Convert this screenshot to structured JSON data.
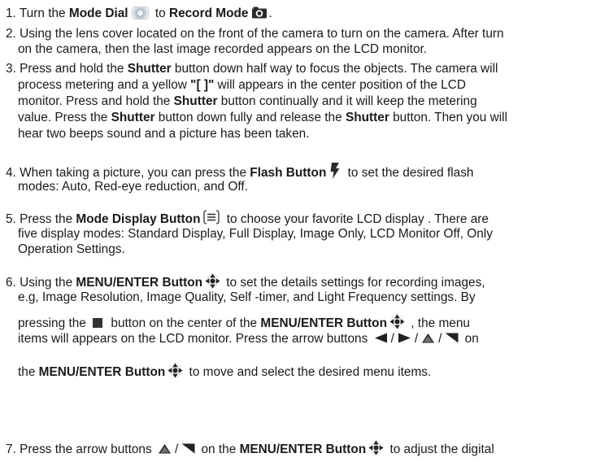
{
  "items": [
    {
      "n": "1. ",
      "a": "Turn the ",
      "mode_dial": "Mode Dial",
      "dial_icon": "mode-dial-icon",
      "b": " to ",
      "record_mode": "Record Mode",
      "camera_icon": "camera-icon",
      "end": "."
    },
    {
      "n": "2. ",
      "line1": "Using the lens cover located on the front of the camera to turn on the camera. After turn",
      "line2": "on the camera, then the last image recorded appears on the LCD monitor."
    },
    {
      "n": "3. ",
      "l1a": "Press and hold the ",
      "shutter": "Shutter",
      "l1b": " button down half way to focus the objects. The camera will",
      "l2a": "process metering and a yellow ",
      "bracket": "\"[ ]\"",
      "l2b": " will appears in the center position of the LCD",
      "l3a": "monitor. Press and hold the ",
      "l3b": " button continually and it will keep the metering",
      "l4a": "value. Press the ",
      "l4b": " button down fully and release the ",
      "l4c": " button. Then you will",
      "l5": "hear two beeps sound and a picture has been taken."
    },
    {
      "n": "4. ",
      "l1a": "When taking a picture, you can press the ",
      "flash_button": "Flash Button",
      "flash_icon": "flash-icon",
      "l1b": " to set the desired flash",
      "l2": "modes: Auto, Red-eye reduction, and Off."
    },
    {
      "n": "5. ",
      "l1a": "Press the ",
      "mode_display_button": "Mode Display Button",
      "display_icon": "display-mode-icon",
      "l1b": " to choose your favorite LCD display . There are",
      "l2": "five display modes: Standard Display, Full Display, Image Only, LCD Monitor Off, Only",
      "l3": "Operation Settings."
    },
    {
      "n": "6. ",
      "l1a": "Using the ",
      "menu_enter": "MENU/ENTER Button",
      "pad_icon": "four-way-pad-icon",
      "l1b": " to set the details settings for recording images,",
      "l2": "e.g, Image Resolution, Image Quality, Self -timer, and Light Frequency settings. By",
      "l3a": "pressing the ",
      "square_icon": "center-square-button-icon",
      "l3b": " button on the center of the ",
      "l3c": " , the menu",
      "l4a": "items will appears on the LCD monitor. Press the arrow buttons ",
      "slash": "/",
      "arrow_icons": [
        "left-arrow-icon",
        "right-arrow-icon",
        "up-arrow-icon",
        "down-arrow-icon"
      ],
      "l4b": " on",
      "l5a": "the ",
      "l5b": " to move and select the desired menu items."
    },
    {
      "n": "7. ",
      "l1a": "Press the arrow buttons ",
      "l1b": " on the ",
      "l1c": " to adjust the digital"
    }
  ]
}
